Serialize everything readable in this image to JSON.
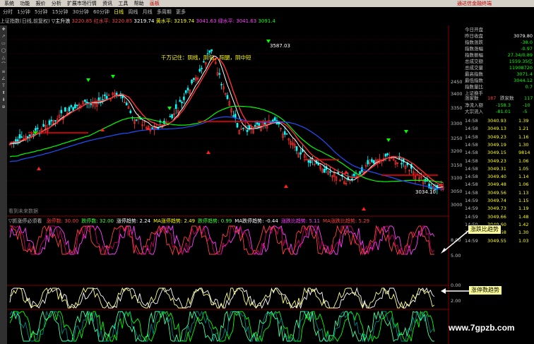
{
  "menubar": {
    "items": [
      "系统",
      "功能",
      "报价",
      "分析",
      "扩展市场行情",
      "资讯",
      "工具",
      "帮助"
    ],
    "active": "画板",
    "brand": "通达信金融终端"
  },
  "periods": [
    "分时",
    "1分钟",
    "5分钟",
    "15分钟",
    "30分钟",
    "60分钟",
    "日线",
    "周线",
    "月线",
    "多周期",
    "更多"
  ],
  "selected_period": "日线",
  "infobar": {
    "symbol": "上证指数(日线,前复权)",
    "indicator": "▽主升浪",
    "v1": "3220.85",
    "v2_label": "红水平:",
    "v2": "3220.85",
    "v3": "3219.74",
    "v4_label": "黄水平:",
    "v4": "3219.74",
    "v5": "3041.63",
    "v6_label": "绿水平:",
    "v6": "3041.63",
    "v7": "3091.4"
  },
  "annotations": {
    "chart_note": "千万记住：阴线，阴包，阳腿，阴中短",
    "high_label": "3587.03",
    "low_label": "3034.10",
    "future_note": "看到未来数据"
  },
  "indicator_title": {
    "name": "▽抓涨停必须看",
    "items": [
      {
        "label": "涨停数:",
        "value": "30.00",
        "color": "#ff4040"
      },
      {
        "label": "跌停数:",
        "value": "32.00",
        "color": "#40ff40"
      },
      {
        "label": "涨停趋势:",
        "value": "2.24",
        "color": "#ffffff"
      },
      {
        "label": "MA涨停趋势:",
        "value": "2.49",
        "color": "#ffff00"
      },
      {
        "label": "跌停趋势:",
        "value": "0.99",
        "color": "#40ff40"
      },
      {
        "label": "MA跌停趋势:",
        "value": "-0.44",
        "color": "#ffffff"
      },
      {
        "label": "涨跌比趋势:",
        "value": "5.11",
        "color": "#ff40ff"
      },
      {
        "label": "MA涨跌比趋势:",
        "value": "5.29",
        "color": "#ff4040"
      }
    ]
  },
  "yaxis": [
    "2450",
    "3400",
    "3350",
    "3300",
    "3250",
    "3200",
    "3150",
    "3100",
    "3050",
    "3000"
  ],
  "yaxis_low": [
    "8.00",
    "5.00",
    "0.00",
    "2.00"
  ],
  "callouts": {
    "ratio": "涨跌比趋势",
    "count": "涨停数趋势"
  },
  "watermark": "www.7gpzb.com",
  "quote_panel": {
    "rows": [
      {
        "label": "今日开盘",
        "value": ""
      },
      {
        "label": "昨日收盘",
        "value": "3079.80"
      },
      {
        "label": "指数涨跌",
        "value": "-38.0"
      },
      {
        "label": "指数涨幅",
        "value": "-0.97"
      },
      {
        "label": "指数振幅",
        "value": "27.34/0.89"
      },
      {
        "label": "总成交额",
        "value": "1559.35亿"
      },
      {
        "label": "总成交量",
        "value": "11908720"
      },
      {
        "label": "最高指数",
        "value": "3071.4"
      },
      {
        "label": "最低指数",
        "value": "3044.12"
      },
      {
        "label": "指数量比",
        "value": "0.7"
      },
      {
        "label": "上证换手",
        "value": ""
      }
    ],
    "updown": {
      "up_label": "涨家数",
      "up": "187",
      "down_label": "跌家数",
      "down": "117"
    },
    "flows": [
      {
        "label": "净流入额",
        "v1": "-158.3",
        "v2": "-10"
      },
      {
        "label": "大宗流入",
        "v1": "-81.01",
        "v2": "-5"
      }
    ],
    "ticks": [
      {
        "t": "14:58",
        "p": "3040.93",
        "v": "1.39"
      },
      {
        "t": "14:58",
        "p": "3049.13",
        "v": "1.21"
      },
      {
        "t": "14:58",
        "p": "3049.23",
        "v": "1.16"
      },
      {
        "t": "14:58",
        "p": "3049.19",
        "v": "1.30"
      },
      {
        "t": "14:58",
        "p": "3049.15",
        "v": "9814"
      },
      {
        "t": "14:58",
        "p": "3049.23",
        "v": "1.06"
      },
      {
        "t": "14:58",
        "p": "3049.31",
        "v": "1.05"
      },
      {
        "t": "14:58",
        "p": "3049.40",
        "v": "1.14"
      },
      {
        "t": "14:58",
        "p": "3049.48",
        "v": "1.06"
      },
      {
        "t": "14:58",
        "p": "3049.56",
        "v": "1.13"
      },
      {
        "t": "14:59",
        "p": "3049.74",
        "v": "1.15"
      },
      {
        "t": "14:59",
        "p": "3049.73",
        "v": "1.19"
      },
      {
        "t": "14:59",
        "p": "3049.66",
        "v": "1.48"
      },
      {
        "t": "14:59",
        "p": "3049.60",
        "v": "1.42"
      },
      {
        "t": "14:59",
        "p": "3049.58",
        "v": "1.30"
      },
      {
        "t": "14:59",
        "p": "3049.55",
        "v": "1.03"
      }
    ]
  },
  "colors": {
    "up": "#ff3030",
    "down": "#00ffff",
    "ma_white": "#ffffff",
    "ma_yellow": "#ffff00",
    "ma_green": "#00ff00",
    "ma_blue": "#2050ff",
    "red_flat": "#ff0000"
  }
}
